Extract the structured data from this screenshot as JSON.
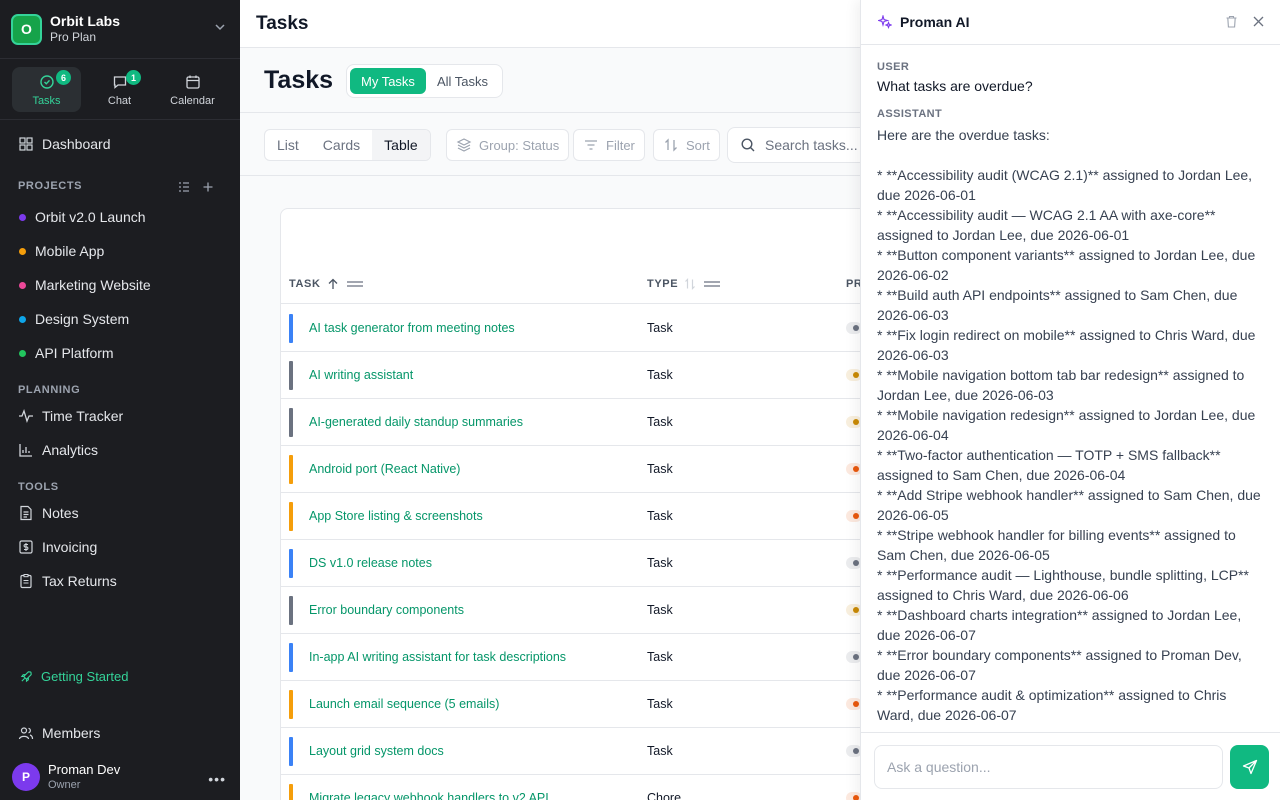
{
  "org": {
    "initial": "O",
    "name": "Orbit Labs",
    "plan": "Pro Plan"
  },
  "mode_tabs": [
    {
      "label": "Tasks",
      "badge": "6",
      "icon": "tasks-icon"
    },
    {
      "label": "Chat",
      "badge": "1",
      "icon": "chat-icon"
    },
    {
      "label": "Calendar",
      "badge": "",
      "icon": "calendar-icon"
    }
  ],
  "nav": {
    "dashboard": "Dashboard",
    "projects_label": "PROJECTS",
    "projects": [
      {
        "label": "Orbit v2.0 Launch",
        "color": "#7c3aed"
      },
      {
        "label": "Mobile App",
        "color": "#f59e0b"
      },
      {
        "label": "Marketing Website",
        "color": "#ec4899"
      },
      {
        "label": "Design System",
        "color": "#0ea5e9"
      },
      {
        "label": "API Platform",
        "color": "#22c55e"
      }
    ],
    "planning_label": "PLANNING",
    "time_tracker": "Time Tracker",
    "analytics": "Analytics",
    "tools_label": "TOOLS",
    "notes": "Notes",
    "invoicing": "Invoicing",
    "tax_returns": "Tax Returns",
    "getting_started": "Getting Started",
    "members": "Members"
  },
  "user": {
    "initial": "P",
    "name": "Proman Dev",
    "role": "Owner"
  },
  "topbar": {
    "title": "Tasks"
  },
  "page": {
    "title": "Tasks",
    "scope": {
      "mine": "My Tasks",
      "all": "All Tasks"
    }
  },
  "toolbar": {
    "views": [
      "List",
      "Cards",
      "Table"
    ],
    "group": "Group: Status",
    "filter": "Filter",
    "sort": "Sort",
    "search_placeholder": "Search tasks..."
  },
  "table": {
    "columns": {
      "task": "TASK",
      "type": "TYPE",
      "priority": "PR"
    },
    "rows": [
      {
        "task": "AI task generator from meeting notes",
        "type": "Task",
        "bar": "#3b82f6",
        "pri": "#6b7280"
      },
      {
        "task": "AI writing assistant",
        "type": "Task",
        "bar": "#6b7280",
        "pri": "#ca8a04"
      },
      {
        "task": "AI-generated daily standup summaries",
        "type": "Task",
        "bar": "#6b7280",
        "pri": "#ca8a04"
      },
      {
        "task": "Android port (React Native)",
        "type": "Task",
        "bar": "#f59e0b",
        "pri": "#ea580c"
      },
      {
        "task": "App Store listing & screenshots",
        "type": "Task",
        "bar": "#f59e0b",
        "pri": "#ea580c"
      },
      {
        "task": "DS v1.0 release notes",
        "type": "Task",
        "bar": "#3b82f6",
        "pri": "#6b7280"
      },
      {
        "task": "Error boundary components",
        "type": "Task",
        "bar": "#6b7280",
        "pri": "#ca8a04"
      },
      {
        "task": "In-app AI writing assistant for task descriptions",
        "type": "Task",
        "bar": "#3b82f6",
        "pri": "#6b7280"
      },
      {
        "task": "Launch email sequence (5 emails)",
        "type": "Task",
        "bar": "#f59e0b",
        "pri": "#ea580c"
      },
      {
        "task": "Layout grid system docs",
        "type": "Task",
        "bar": "#3b82f6",
        "pri": "#6b7280"
      },
      {
        "task": "Migrate legacy webhook handlers to v2 API",
        "type": "Chore",
        "bar": "#f59e0b",
        "pri": "#ea580c"
      }
    ]
  },
  "ai": {
    "title": "Proman AI",
    "user_label": "USER",
    "user_message": "What tasks are overdue?",
    "assistant_label": "ASSISTANT",
    "intro": "Here are the overdue tasks:",
    "items": [
      "*   **Accessibility audit (WCAG 2.1)** assigned to Jordan Lee, due 2026-06-01",
      "*   **Accessibility audit — WCAG 2.1 AA with axe-core** assigned to Jordan Lee, due 2026-06-01",
      "*   **Button component variants** assigned to Jordan Lee, due 2026-06-02",
      "*   **Build auth API endpoints** assigned to Sam Chen, due 2026-06-03",
      "*   **Fix login redirect on mobile** assigned to Chris Ward, due 2026-06-03",
      "*   **Mobile navigation bottom tab bar redesign** assigned to Jordan Lee, due 2026-06-03",
      "*   **Mobile navigation redesign** assigned to Jordan Lee, due 2026-06-04",
      "*   **Two-factor authentication — TOTP + SMS fallback** assigned to Sam Chen, due 2026-06-04",
      "*   **Add Stripe webhook handler** assigned to Sam Chen, due 2026-06-05",
      "*   **Stripe webhook handler for billing events** assigned to Sam Chen, due 2026-06-05",
      "*   **Performance audit — Lighthouse, bundle splitting, LCP** assigned to Chris Ward, due 2026-06-06",
      "*   **Dashboard charts integration** assigned to Jordan Lee, due 2026-06-07",
      "*   **Error boundary components** assigned to Proman Dev, due 2026-06-07",
      "*   **Performance audit & optimization** assigned to Chris Ward, due 2026-06-07"
    ],
    "input_placeholder": "Ask a question..."
  },
  "colors": {
    "accent": "#10b981",
    "sidebar_bg": "#1c1d21",
    "link": "#059669"
  }
}
